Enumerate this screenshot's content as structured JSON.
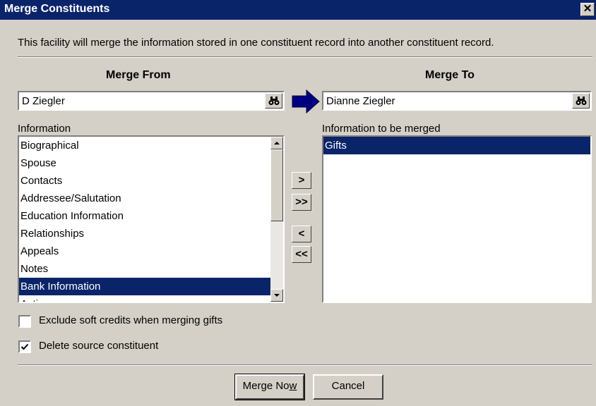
{
  "window": {
    "title": "Merge Constituents",
    "close_glyph": "✕"
  },
  "description": "This facility will merge the information stored in one constituent record into another constituent record.",
  "from": {
    "header": "Merge From",
    "value": "D Ziegler",
    "list_label": "Information",
    "items": [
      "Biographical",
      "Spouse",
      "Contacts",
      "Addressee/Salutation",
      "Education Information",
      "Relationships",
      "Appeals",
      "Notes",
      "Bank Information",
      "Actions"
    ],
    "selected_index": 8
  },
  "to": {
    "header": "Merge To",
    "value": "Dianne Ziegler",
    "list_label": "Information to be merged",
    "items": [
      "Gifts"
    ],
    "selected_index": 0
  },
  "move_buttons": {
    "add": ">",
    "add_all": ">>",
    "remove": "<",
    "remove_all": "<<"
  },
  "options": {
    "exclude_soft_credits": {
      "label": "Exclude soft credits when merging gifts",
      "checked": false
    },
    "delete_source": {
      "label": "Delete source constituent",
      "checked": true
    }
  },
  "buttons": {
    "merge_now_prefix": "Merge No",
    "merge_now_accel": "w",
    "cancel": "Cancel"
  },
  "colors": {
    "selection": "#0a246a",
    "face": "#d4d0c8",
    "arrow": "#000080"
  },
  "icons": {
    "find": "binoculars-icon",
    "arrow": "right-arrow-icon",
    "check": "checkmark-icon"
  }
}
